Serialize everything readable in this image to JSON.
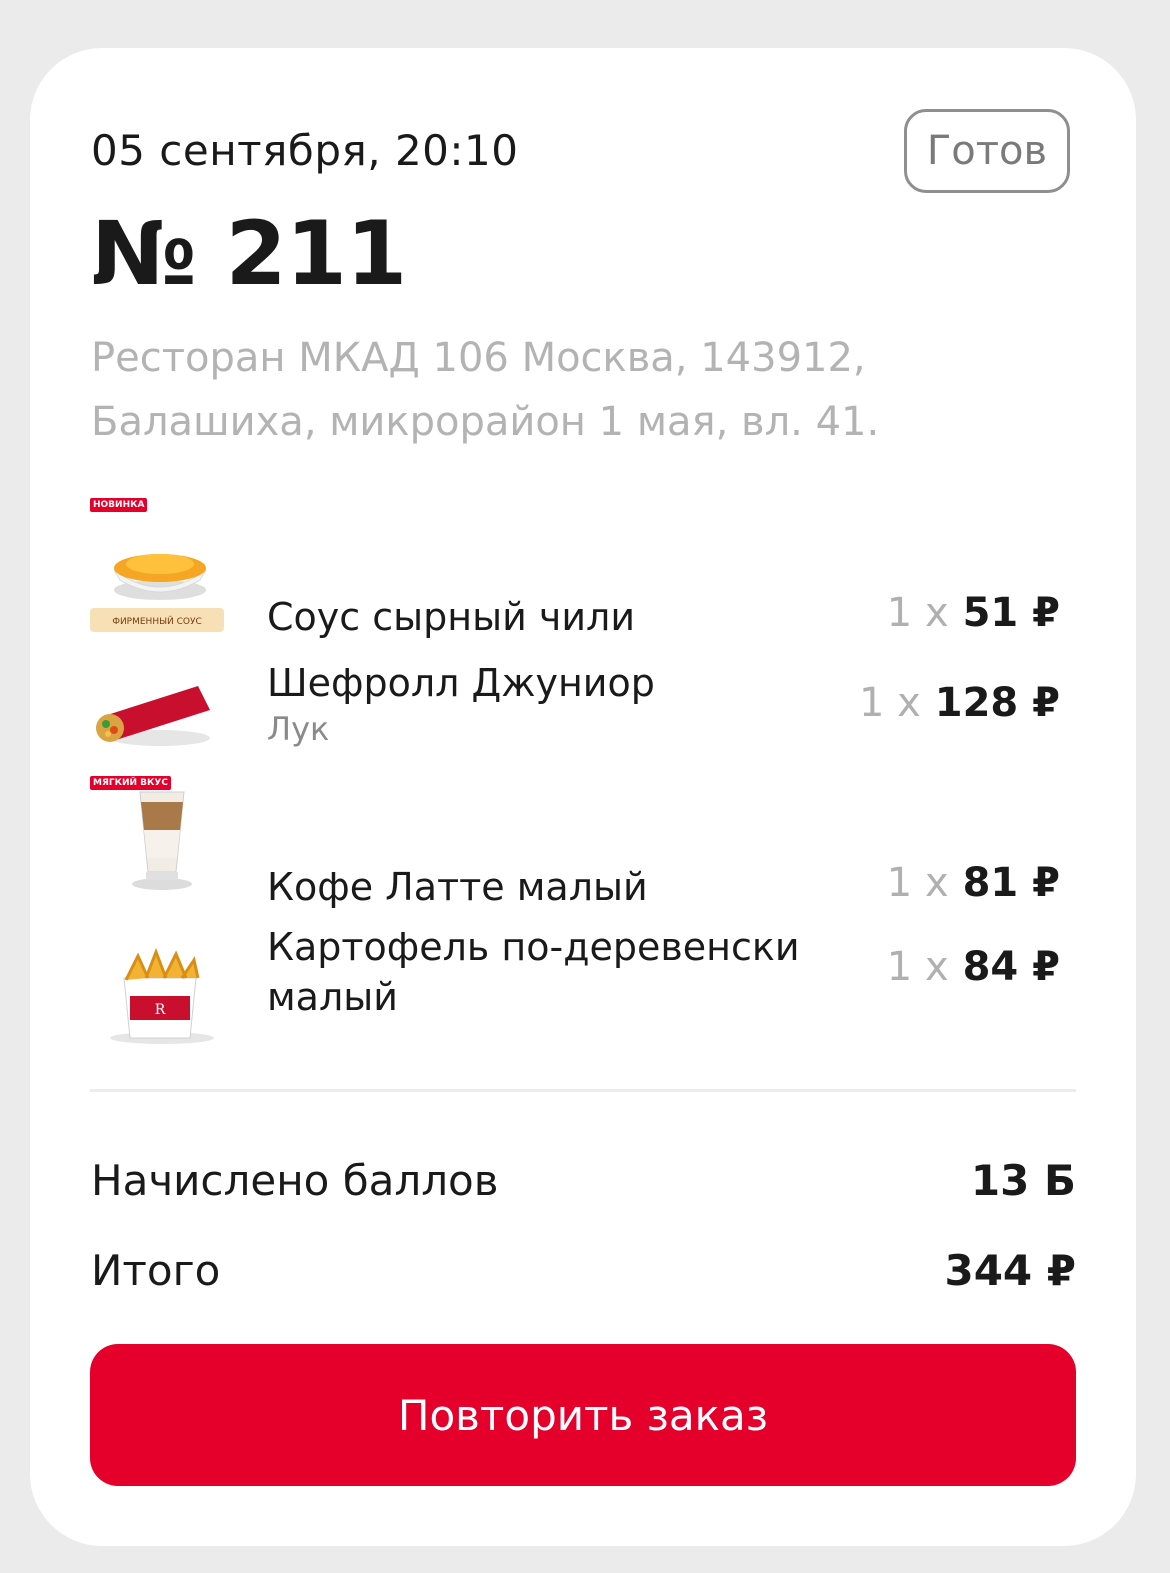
{
  "order": {
    "date": "05 сентября, 20:10",
    "status": "Готов",
    "number": "№ 211",
    "address": "Ресторан МКАД 106 Москва, 143912, Балашиха, микрорайон 1 мая, вл. 41."
  },
  "items": [
    {
      "name": "Соус сырный чили",
      "qty": "1 x",
      "price": "51 ₽",
      "badge": "НОВИНКА",
      "sub_badge": "ФИРМЕННЫЙ СОУС"
    },
    {
      "name": "Шефролл Джуниор",
      "modifier": "Лук",
      "qty": "1 x",
      "price": "128 ₽"
    },
    {
      "name": "Кофе Латте малый",
      "qty": "1 x",
      "price": "81 ₽",
      "badge": "МЯГКИЙ ВКУС"
    },
    {
      "name": "Картофель по-деревенски малый",
      "qty": "1 x",
      "price": "84 ₽"
    }
  ],
  "summary": {
    "points_label": "Начислено баллов",
    "points_value": "13 Б",
    "total_label": "Итого",
    "total_value": "344 ₽"
  },
  "repeat_button": "Повторить заказ",
  "colors": {
    "accent": "#e4002b",
    "status_border": "#8f8f8f",
    "muted": "#b3b3b3"
  }
}
